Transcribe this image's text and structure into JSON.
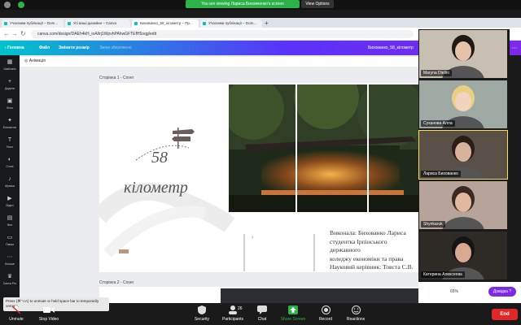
{
  "zoom_top": {
    "share_banner": "You are viewing Лариса Биховченко's screen",
    "view_options": "View Options"
  },
  "browser": {
    "tabs": [
      {
        "label": "Учасники публікації – Dom..."
      },
      {
        "label": "Усі ваші дизайни – Canva"
      },
      {
        "label": "Бихованко_58_кілометр – Пр..."
      },
      {
        "label": "Учасники публікації – Dom..."
      }
    ],
    "url": "canva.com/design/DAEh4kH_ioA/lrj1WpvhPAhwGFTEfH5oqg/edit"
  },
  "canva": {
    "home": "Головна",
    "file": "Файл",
    "resize": "Змінити розмір",
    "saved": "Зміни збережено",
    "doc_title": "Бихованко_58_кілометр",
    "animation": "Анімація",
    "page1_label": "Сторінка 1 - Cover",
    "page2_label": "Сторінка 2 - Cover",
    "number": "58",
    "word": "кілометр",
    "vykonala": "Виконала: Бихованко Лариса\nстудентка Ірпінського державного\nколеджу економіки та права\nНауковий керівник: Товста С.В.",
    "zoom_pct": "65%",
    "help": "Довідка ?",
    "page_num": "1"
  },
  "sidebar": [
    {
      "label": "Шаблони"
    },
    {
      "label": "Додати"
    },
    {
      "label": "Фото"
    },
    {
      "label": "Елементи"
    },
    {
      "label": "Текст"
    },
    {
      "label": "Стилі"
    },
    {
      "label": "Музика"
    },
    {
      "label": "Відео"
    },
    {
      "label": "Фон"
    },
    {
      "label": "Папки"
    },
    {
      "label": "Більше"
    },
    {
      "label": "Canva Pro"
    }
  ],
  "gallery": [
    {
      "name": "Maryna Dielini"
    },
    {
      "name": "Суханова Алла"
    },
    {
      "name": "Лариса Бихованко"
    },
    {
      "name": "Shynkaruk"
    },
    {
      "name": "Катерина Алексеева"
    }
  ],
  "zoom_bar": {
    "unmute": "Unmute",
    "stop_video": "Stop Video",
    "security": "Security",
    "participants": "Participants",
    "participants_count": "26",
    "chat": "Chat",
    "share_screen": "Share Screen",
    "record": "Record",
    "reactions": "Reactions",
    "end": "End",
    "tooltip": "Press (⌘⌥A) to unmute or hold space bar to temporarily unmute."
  }
}
